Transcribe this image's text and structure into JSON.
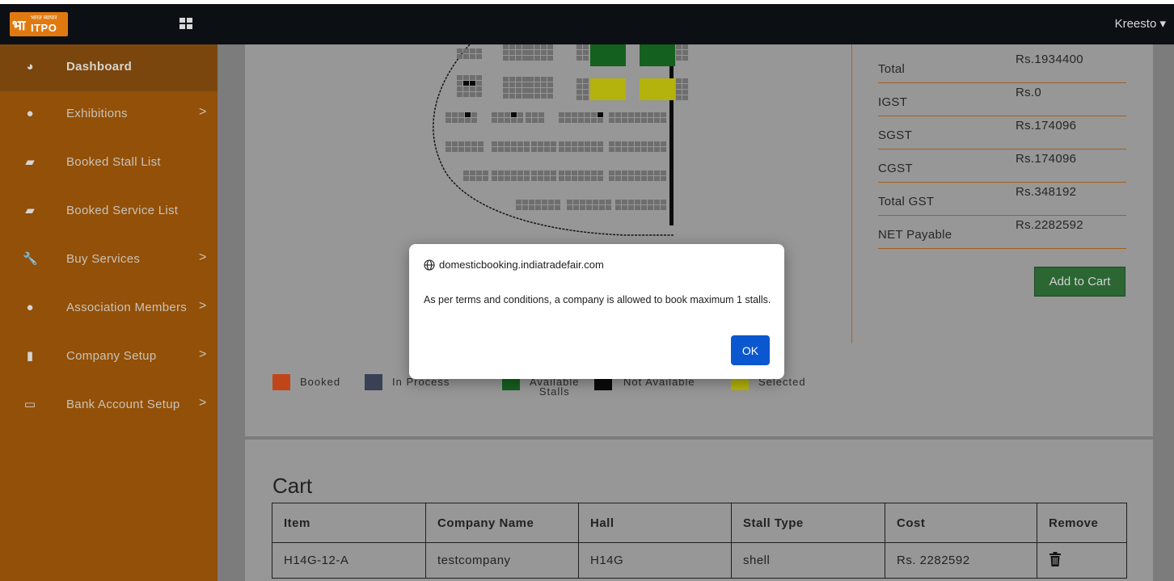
{
  "header": {
    "logo_symbol": "भा",
    "logo_small": "भारत व्यापार",
    "logo_text": "ITPO",
    "user": "Kreesto ▾"
  },
  "sidebar": {
    "items": [
      {
        "label": "Dashboard",
        "icon": "dashboard-icon",
        "glyph": "◕",
        "chevron": ""
      },
      {
        "label": "Exhibitions",
        "icon": "globe-icon",
        "glyph": "●",
        "chevron": ">"
      },
      {
        "label": "Booked Stall List",
        "icon": "inbox-icon",
        "glyph": "▰",
        "chevron": ""
      },
      {
        "label": "Booked Service List",
        "icon": "inbox-icon",
        "glyph": "▰",
        "chevron": ""
      },
      {
        "label": "Buy Services",
        "icon": "wrench-icon",
        "glyph": "🔧",
        "chevron": ">"
      },
      {
        "label": "Association Members",
        "icon": "globe-icon",
        "glyph": "●",
        "chevron": ">"
      },
      {
        "label": "Company Setup",
        "icon": "briefcase-icon",
        "glyph": "▮",
        "chevron": ">"
      },
      {
        "label": "Bank Account Setup",
        "icon": "credit-card-icon",
        "glyph": "▭",
        "chevron": ">"
      }
    ]
  },
  "summary": {
    "rows": [
      {
        "label": "Total",
        "value": "Rs.1934400"
      },
      {
        "label": "IGST",
        "value": "Rs.0"
      },
      {
        "label": "SGST",
        "value": "Rs.174096"
      },
      {
        "label": "CGST",
        "value": "Rs.174096"
      },
      {
        "label": "Total GST",
        "value": "Rs.348192"
      },
      {
        "label": "NET Payable",
        "value": "Rs.2282592"
      }
    ],
    "add_to_cart": "Add to Cart"
  },
  "legend": {
    "booked": "Booked",
    "in_process": "In Process",
    "available_1": "Available",
    "available_2": "Stalls",
    "not_available": "Not Available",
    "selected": "Selected"
  },
  "colors": {
    "booked": "#c0461a",
    "in_process": "#3a4157",
    "available": "#14601e",
    "not_available": "#0a0a0a",
    "selected": "#b4b20d",
    "sidebar": "#935008"
  },
  "cart": {
    "title": "Cart",
    "columns": [
      "Item",
      "Company Name",
      "Hall",
      "Stall Type",
      "Cost",
      "Remove"
    ],
    "rows": [
      {
        "item": "H14G-12-A",
        "company": "testcompany",
        "hall": "H14G",
        "stall_type": "shell",
        "cost": "Rs. 2282592"
      }
    ]
  },
  "dialog": {
    "origin": "domesticbooking.indiatradefair.com",
    "message": "As per terms and conditions, a company is allowed to book maximum 1 stalls.",
    "ok": "OK"
  }
}
